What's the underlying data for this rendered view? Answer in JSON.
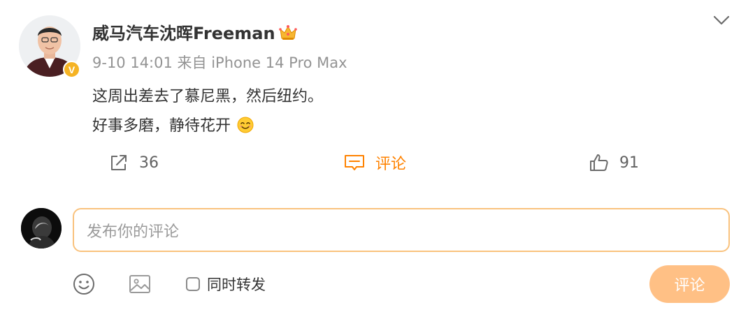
{
  "post": {
    "author": {
      "name": "威马汽车沈晖Freeman",
      "verified_badge": "V",
      "badge_color": "#f5b324",
      "member_icon": "crown-icon"
    },
    "timestamp": "9-10 14:01",
    "source": "来自 iPhone 14 Pro Max",
    "content_lines": [
      "这周出差去了慕尼黑，然后纽约。",
      "好事多磨，静待花开"
    ],
    "content_emoji": "smile-emoji",
    "actions": {
      "share_count": "36",
      "comment_label": "评论",
      "like_count": "91"
    }
  },
  "composer": {
    "placeholder": "发布你的评论",
    "repost_label": "同时转发",
    "submit_label": "评论"
  },
  "colors": {
    "accent": "#ff8200",
    "input_border": "#f9c27d",
    "submit_bg": "#ffc085",
    "meta_text": "#939393"
  }
}
